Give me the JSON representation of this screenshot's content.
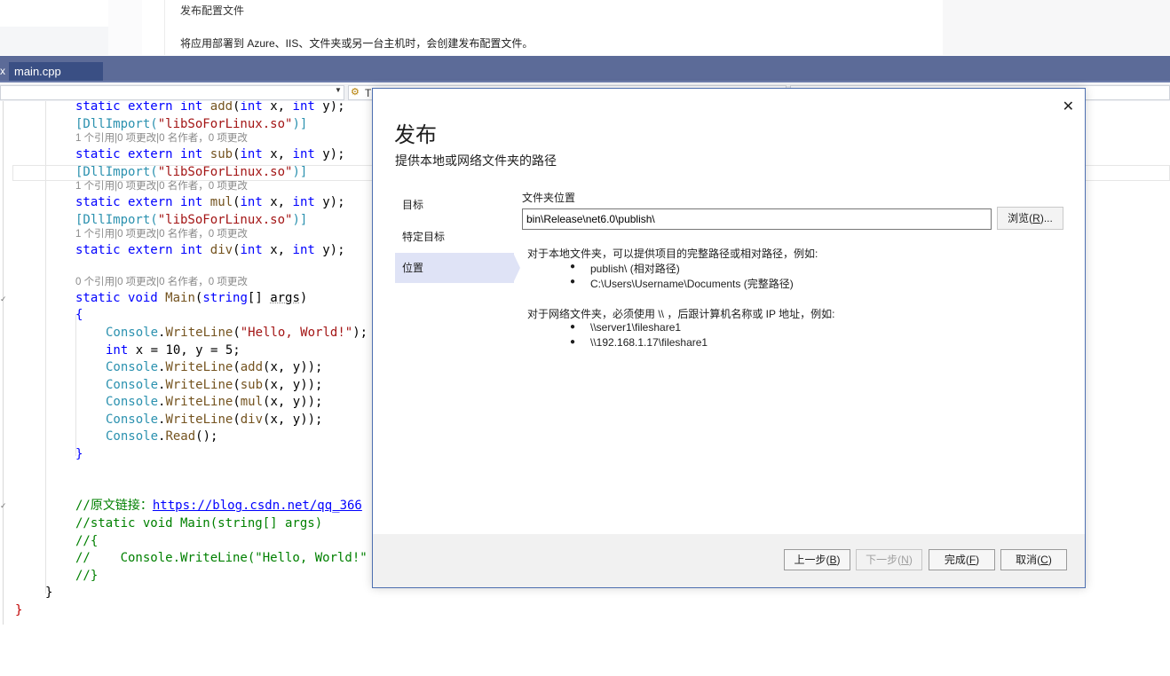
{
  "publish_card": {
    "title": "发布配置文件",
    "description": "将应用部署到 Azure、IIS、文件夹或另一台主机时，会创建发布配置文件。"
  },
  "tabs": {
    "close_glyph": "x",
    "active_tab": "main.cpp"
  },
  "navbar": {
    "member_combo_text": "T"
  },
  "code": {
    "line1": {
      "kw1": "static",
      "kw2": "extern",
      "kw3": "int",
      "name": "add",
      "open": "(",
      "kw4": "int",
      "p1": " x, ",
      "kw5": "int",
      "p2": " y);"
    },
    "import1": "[DllImport(\"libSoForLinux.so\")]",
    "lens1": "1 个引用|0 项更改|0 名作者，0 项更改",
    "line2": {
      "kw1": "static",
      "kw2": "extern",
      "kw3": "int",
      "name": "sub",
      "kw4": "int",
      "p1": " x, ",
      "kw5": "int",
      "p2": " y);"
    },
    "import2": "[DllImport(\"libSoForLinux.so\")]",
    "lens2": "1 个引用|0 项更改|0 名作者，0 项更改",
    "line3": {
      "kw1": "static",
      "kw2": "extern",
      "kw3": "int",
      "name": "mul",
      "kw4": "int",
      "p1": " x, ",
      "kw5": "int",
      "p2": " y);"
    },
    "import3": "[DllImport(\"libSoForLinux.so\")]",
    "lens3": "1 个引用|0 项更改|0 名作者，0 项更改",
    "line4": {
      "kw1": "static",
      "kw2": "extern",
      "kw3": "int",
      "name": "div",
      "kw4": "int",
      "p1": " x, ",
      "kw5": "int",
      "p2": " y);"
    },
    "lens4": "0 个引用|0 项更改|0 名作者，0 项更改",
    "main_sig": {
      "kw1": "static",
      "kw2": "void",
      "name": "Main",
      "open": "(",
      "kw3": "string",
      "rest": "[] ",
      "args": "args",
      ")": ")"
    },
    "open_brace": "{",
    "body1": {
      "cls": "Console",
      "dot": ".",
      "m": "WriteLine",
      "str": "\"Hello, World!\"",
      "end": ");"
    },
    "body2": {
      "kw": "int",
      "rest": " x = 10, y = 5;"
    },
    "body3": {
      "cls": "Console",
      "m": "WriteLine",
      "inner": "add",
      "rest": "(x, y));"
    },
    "body4": {
      "cls": "Console",
      "m": "WriteLine",
      "inner": "sub",
      "rest": "(x, y));"
    },
    "body5": {
      "cls": "Console",
      "m": "WriteLine",
      "inner": "mul",
      "rest": "(x, y));"
    },
    "body6": {
      "cls": "Console",
      "m": "WriteLine",
      "inner": "div",
      "rest": "(x, y));"
    },
    "body7": {
      "cls": "Console",
      "m": "Read",
      "rest": "();"
    },
    "close_brace": "}",
    "comment1_prefix": "//原文链接：",
    "comment1_link": "https://blog.csdn.net/qq_366",
    "comment2": "//static void Main(string[] args)",
    "comment3": "//{",
    "comment4": "//    Console.WriteLine(\"Hello, World!\"",
    "comment5": "//}",
    "class_close": "}",
    "ns_close": "}"
  },
  "dialog": {
    "close_glyph": "✕",
    "title": "发布",
    "subtitle": "提供本地或网络文件夹的路径",
    "nav": [
      "目标",
      "特定目标",
      "位置"
    ],
    "active_nav": "位置",
    "folder_label": "文件夹位置",
    "folder_value": "bin\\Release\\net6.0\\publish\\",
    "browse_label": "浏览(R)...",
    "local_help": "对于本地文件夹，可以提供项目的完整路径或相对路径，例如:",
    "local_examples": [
      "publish\\ (相对路径)",
      "C:\\Users\\Username\\Documents (完整路径)"
    ],
    "network_help": "对于网络文件夹，必须使用 \\\\ ，后跟计算机名称或 IP 地址，例如:",
    "network_examples": [
      "\\\\server1\\fileshare1",
      "\\\\192.168.1.17\\fileshare1"
    ],
    "buttons": {
      "prev": "上一步(B)",
      "next": "下一步(N)",
      "finish": "完成(F)",
      "cancel": "取消(C)"
    }
  }
}
